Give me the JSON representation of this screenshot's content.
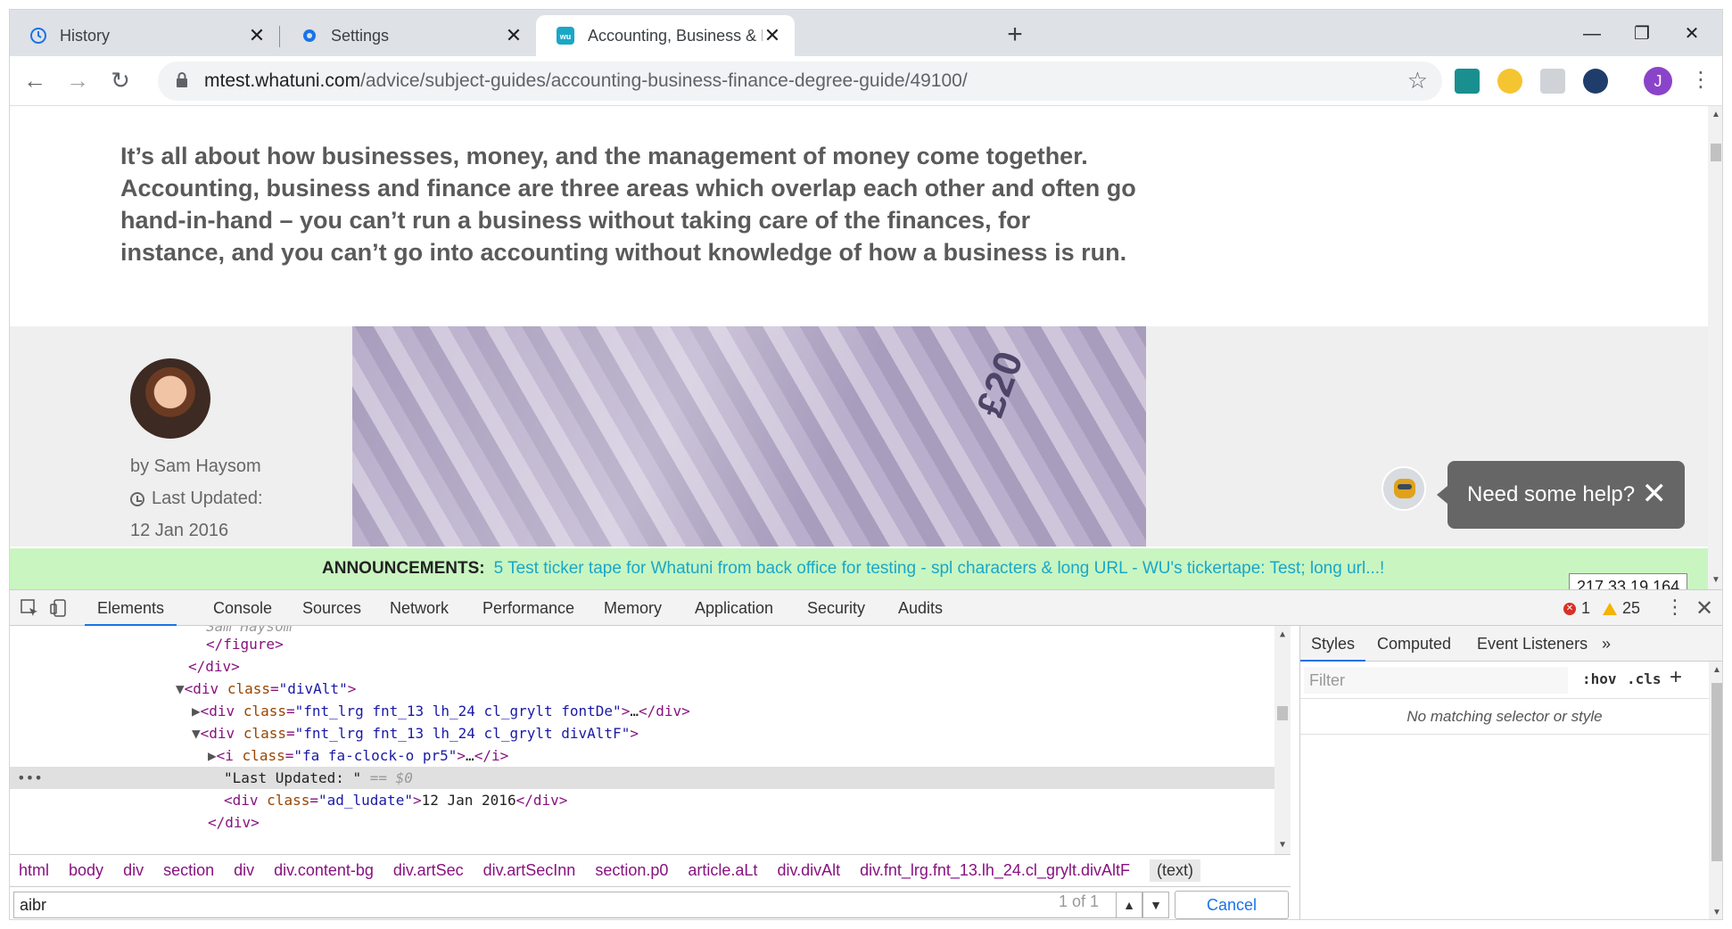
{
  "tabs": [
    {
      "title": "History",
      "icon": "history-icon"
    },
    {
      "title": "Settings",
      "icon": "gear-icon"
    },
    {
      "title": "Accounting, Business & Finance D",
      "icon": "whatuni-icon"
    }
  ],
  "toolbar": {
    "url_host": "mtest.whatuni.com",
    "url_path": "/advice/subject-guides/accounting-business-finance-degree-guide/49100/",
    "profile_initial": "J"
  },
  "page": {
    "intro": "It’s all about how businesses, money, and the management of money come together. Accounting, business and finance are three areas which overlap each other and often go hand-in-hand – you can’t run a business without taking care of the finances, for instance, and you can’t go into accounting without knowledge of how a business is run.",
    "author": "by Sam Haysom",
    "last_updated_label": "Last Updated:",
    "last_updated_date": "12 Jan 2016",
    "banknote_label": "£20",
    "help_text": "Need some help?",
    "announcement_label": "ANNOUNCEMENTS:",
    "announcement_text": "5 Test ticker tape for Whatuni from back office for testing - spl characters & long URL - WU's tickertape: Test; long url...!",
    "ip_address": "217.33.19.164"
  },
  "devtools": {
    "tabs": [
      "Elements",
      "Console",
      "Sources",
      "Network",
      "Performance",
      "Memory",
      "Application",
      "Security",
      "Audits"
    ],
    "errors": "1",
    "warnings": "25",
    "breadcrumbs": [
      "html",
      "body",
      "div",
      "section",
      "div",
      "div.content-bg",
      "div.artSec",
      "div.artSecInn",
      "section.p0",
      "article.aLt",
      "div.divAlt",
      "div.fnt_lrg.fnt_13.lh_24.cl_grylt.divAltF",
      "(text)"
    ],
    "search_value": "aibr",
    "search_count": "1 of 1",
    "cancel_label": "Cancel",
    "styles_tabs": [
      "Styles",
      "Computed",
      "Event Listeners"
    ],
    "filter_placeholder": "Filter",
    "hov_label": ":hov",
    "cls_label": ".cls",
    "no_match": "No matching selector or style",
    "code": {
      "line0": "Sam Haysom",
      "line1_tag": "figure",
      "line2_tag": "div",
      "line3_class": "divAlt",
      "line4_class": "fnt_lrg fnt_13 lh_24 cl_grylt fontDe",
      "line5_class": "fnt_lrg fnt_13 lh_24 cl_grylt divAltF",
      "line6_class": "fa fa-clock-o pr5",
      "line7_text": "\"Last Updated: \"",
      "line7_eq": "== $0",
      "line8_class": "ad_ludate",
      "line8_text": "12 Jan 2016",
      "line9_tag": "div"
    }
  }
}
